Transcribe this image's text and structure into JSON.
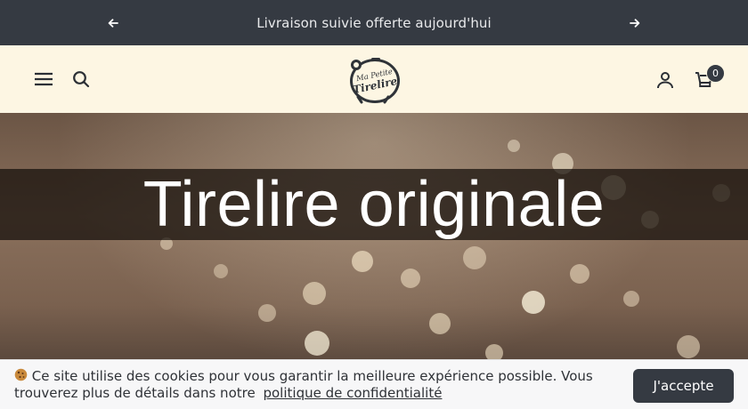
{
  "announcement": {
    "text": "Livraison suivie offerte aujourd'hui",
    "prev_icon": "arrow-left-icon",
    "next_icon": "arrow-right-icon"
  },
  "header": {
    "logo_text": "Ma Petite Tirelire",
    "cart_count": "0",
    "icons": [
      "menu-icon",
      "search-icon",
      "account-icon",
      "cart-icon"
    ]
  },
  "hero": {
    "title": "Tirelire originale"
  },
  "cookie_banner": {
    "text": "Ce site utilise des cookies pour vous garantir la meilleure expérience possible. Vous trouverez plus de détails dans notre",
    "link_text": "politique de confidentialité",
    "accept_label": "J'accepte",
    "emoji_icon": "cookie-icon"
  },
  "colors": {
    "dark": "#353a42",
    "header_bg": "#fdf6e3",
    "banner_bg": "#f7f7f8"
  }
}
